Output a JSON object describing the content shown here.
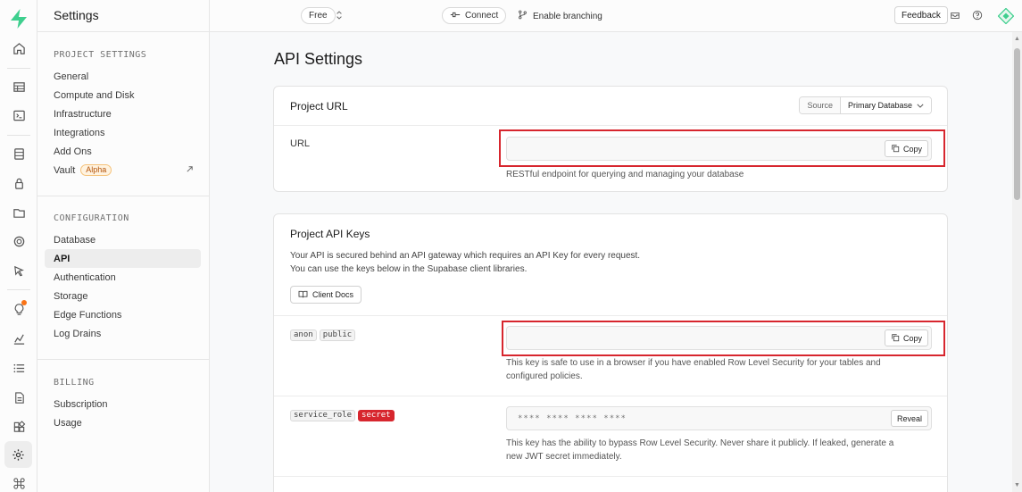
{
  "menu": {
    "title": "Settings",
    "sections": [
      {
        "heading": "PROJECT SETTINGS",
        "items": [
          "General",
          "Compute and Disk",
          "Infrastructure",
          "Integrations",
          "Add Ons",
          "Vault"
        ]
      },
      {
        "heading": "CONFIGURATION",
        "items": [
          "Database",
          "API",
          "Authentication",
          "Storage",
          "Edge Functions",
          "Log Drains"
        ]
      },
      {
        "heading": "BILLING",
        "items": [
          "Subscription",
          "Usage"
        ]
      }
    ],
    "vault_badge": "Alpha",
    "active_item": "API"
  },
  "topbar": {
    "plan": "Free",
    "connect": "Connect",
    "branching": "Enable branching",
    "feedback": "Feedback"
  },
  "page": {
    "title": "API Settings",
    "project_url": {
      "title": "Project URL",
      "source_label": "Source",
      "source_value": "Primary Database",
      "url_label": "URL",
      "url_value": "",
      "copy_label": "Copy",
      "hint": "RESTful endpoint for querying and managing your database"
    },
    "api_keys": {
      "title": "Project API Keys",
      "desc_line1": "Your API is secured behind an API gateway which requires an API Key for every request.",
      "desc_line2": "You can use the keys below in the Supabase client libraries.",
      "client_docs": "Client Docs",
      "anon": {
        "tag1": "anon",
        "tag2": "public",
        "value": "",
        "copy_label": "Copy",
        "hint_line1": "This key is safe to use in a browser if you have enabled Row Level Security for your tables and",
        "hint_line2": "configured policies."
      },
      "service_role": {
        "tag1": "service_role",
        "tag2": "secret",
        "masked": "**** **** **** ****",
        "reveal_label": "Reveal",
        "hint_line1": "This key has the ability to bypass Row Level Security. Never share it publicly. If leaked, generate a",
        "hint_line2": "new JWT secret immediately."
      }
    }
  },
  "colors": {
    "brand": "#3ecf8e",
    "highlight": "#d7262e",
    "notification": "#f97316"
  }
}
